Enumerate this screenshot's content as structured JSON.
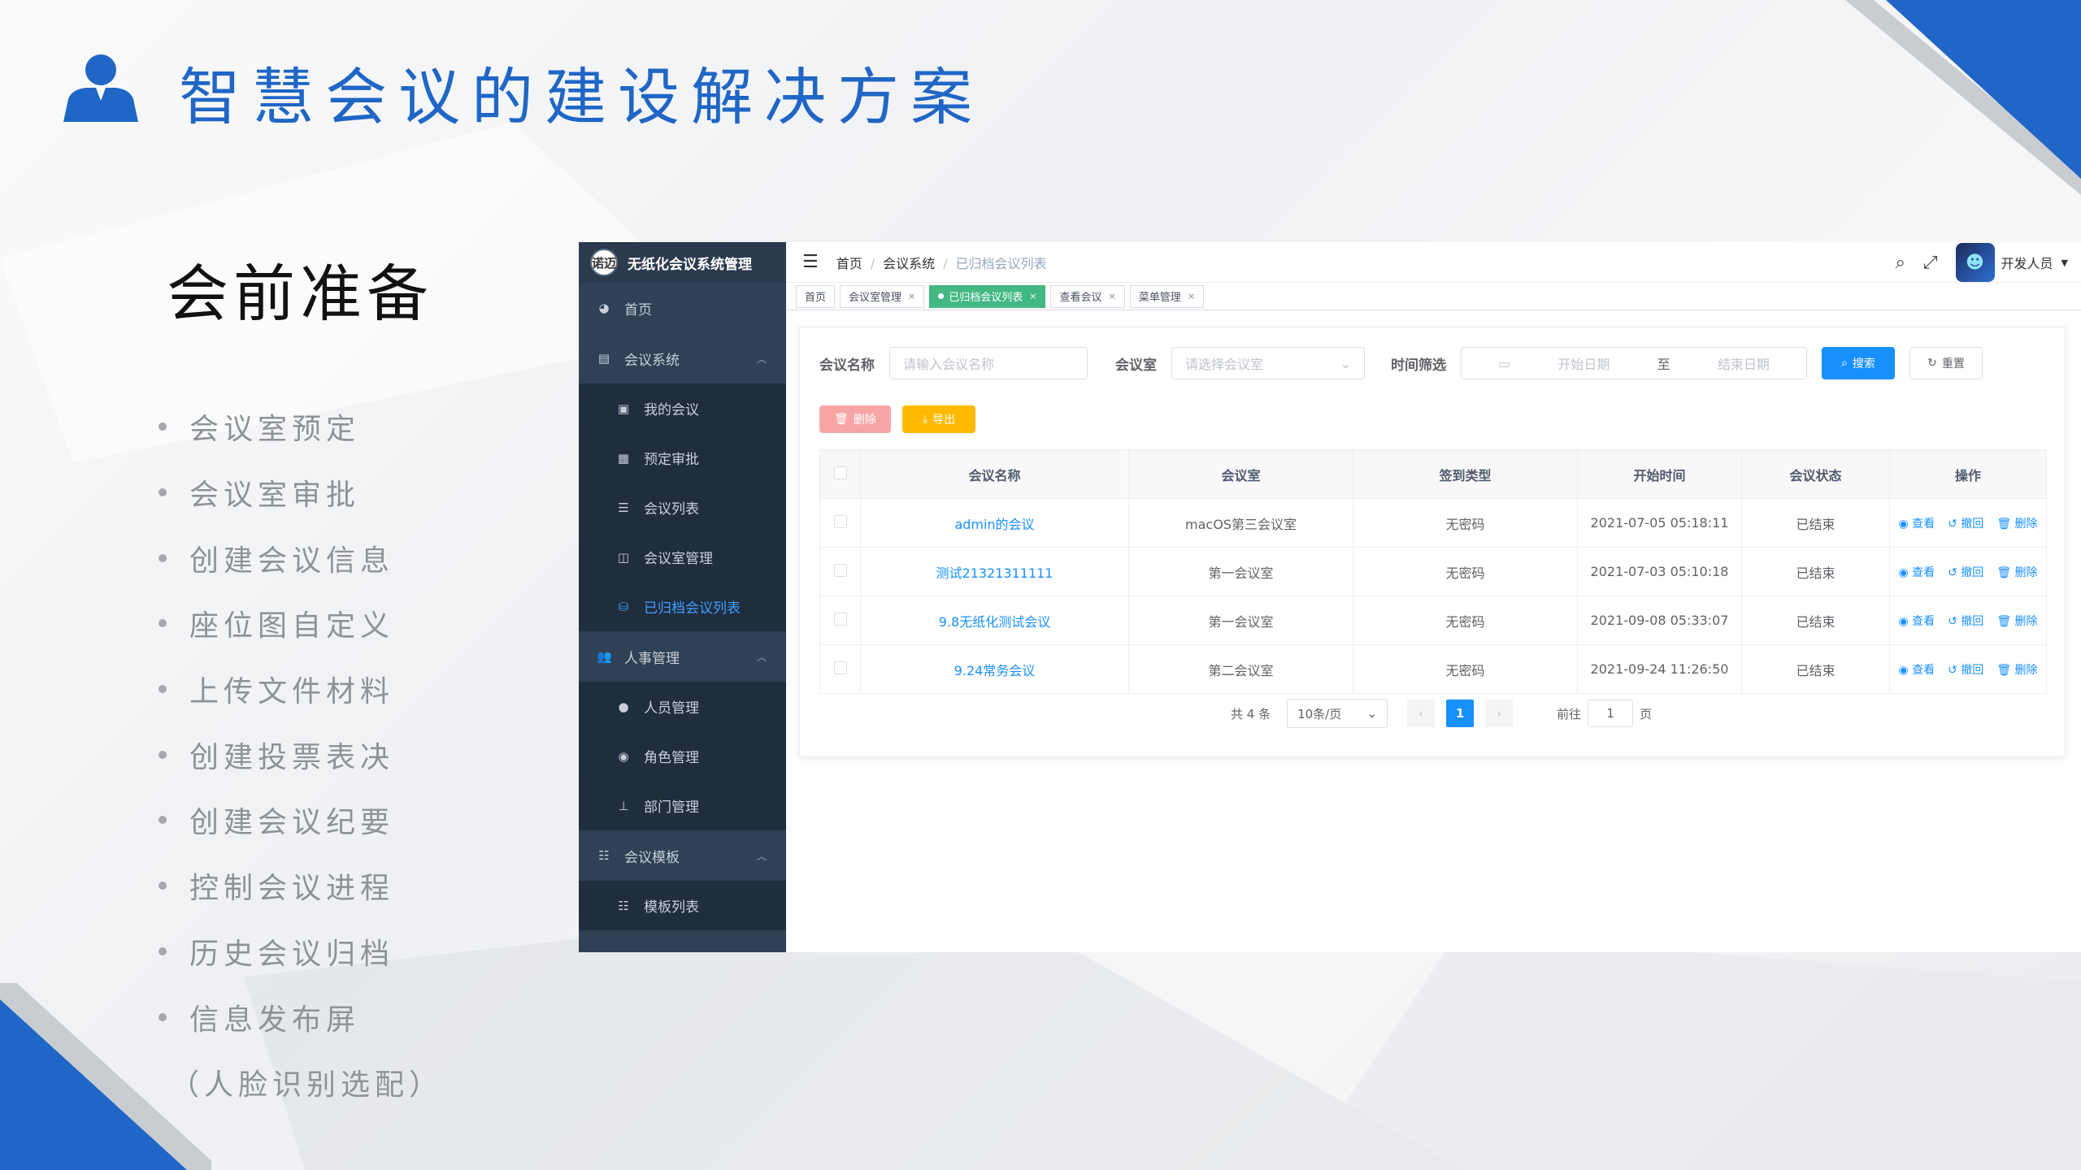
{
  "slide": {
    "title": "智慧会议的建设解决方案",
    "section_title": "会前准备",
    "bullets": [
      "会议室预定",
      "会议室审批",
      "创建会议信息",
      "座位图自定义",
      "上传文件材料",
      "创建投票表决",
      "创建会议纪要",
      "控制会议进程",
      "历史会议归档",
      "信息发布屏"
    ],
    "note": "（人脸识别选配）",
    "accent_color": "#1f66c6"
  },
  "app": {
    "brand": {
      "logo_text": "诺迈",
      "name": "无纸化会议系统管理"
    },
    "sidebar": {
      "home": "首页",
      "meeting_system": "会议系统",
      "meeting_items": [
        "我的会议",
        "预定审批",
        "会议列表",
        "会议室管理",
        "已归档会议列表"
      ],
      "hr": "人事管理",
      "hr_items": [
        "人员管理",
        "角色管理",
        "部门管理"
      ],
      "template": "会议模板",
      "template_items": [
        "模板列表"
      ]
    },
    "breadcrumb": [
      "首页",
      "会议系统",
      "已归档会议列表"
    ],
    "user": "开发人员",
    "tags": [
      "首页",
      "会议室管理",
      "已归档会议列表",
      "查看会议",
      "菜单管理"
    ],
    "form": {
      "name_label": "会议名称",
      "name_placeholder": "请输入会议名称",
      "room_label": "会议室",
      "room_placeholder": "请选择会议室",
      "time_label": "时间筛选",
      "start_placeholder": "开始日期",
      "range_sep": "至",
      "end_placeholder": "结束日期",
      "search": "搜索",
      "reset": "重置",
      "delete": "删除",
      "export": "导出"
    },
    "table": {
      "headers": [
        "会议名称",
        "会议室",
        "签到类型",
        "开始时间",
        "会议状态",
        "操作"
      ],
      "rows": [
        [
          "admin的会议",
          "macOS第三会议室",
          "无密码",
          "2021-07-05 05:18:11",
          "已结束"
        ],
        [
          "测试21321311111",
          "第一会议室",
          "无密码",
          "2021-07-03 05:10:18",
          "已结束"
        ],
        [
          "9.8无纸化测试会议",
          "第一会议室",
          "无密码",
          "2021-09-08 05:33:07",
          "已结束"
        ],
        [
          "9.24常务会议",
          "第二会议室",
          "无密码",
          "2021-09-24 11:26:50",
          "已结束"
        ]
      ],
      "actions": [
        "查看",
        "撤回",
        "删除"
      ]
    },
    "pager": {
      "total": "共 4 条",
      "size": "10条/页",
      "current": "1",
      "goto": "前往",
      "goto_value": "1",
      "page_unit": "页"
    }
  }
}
